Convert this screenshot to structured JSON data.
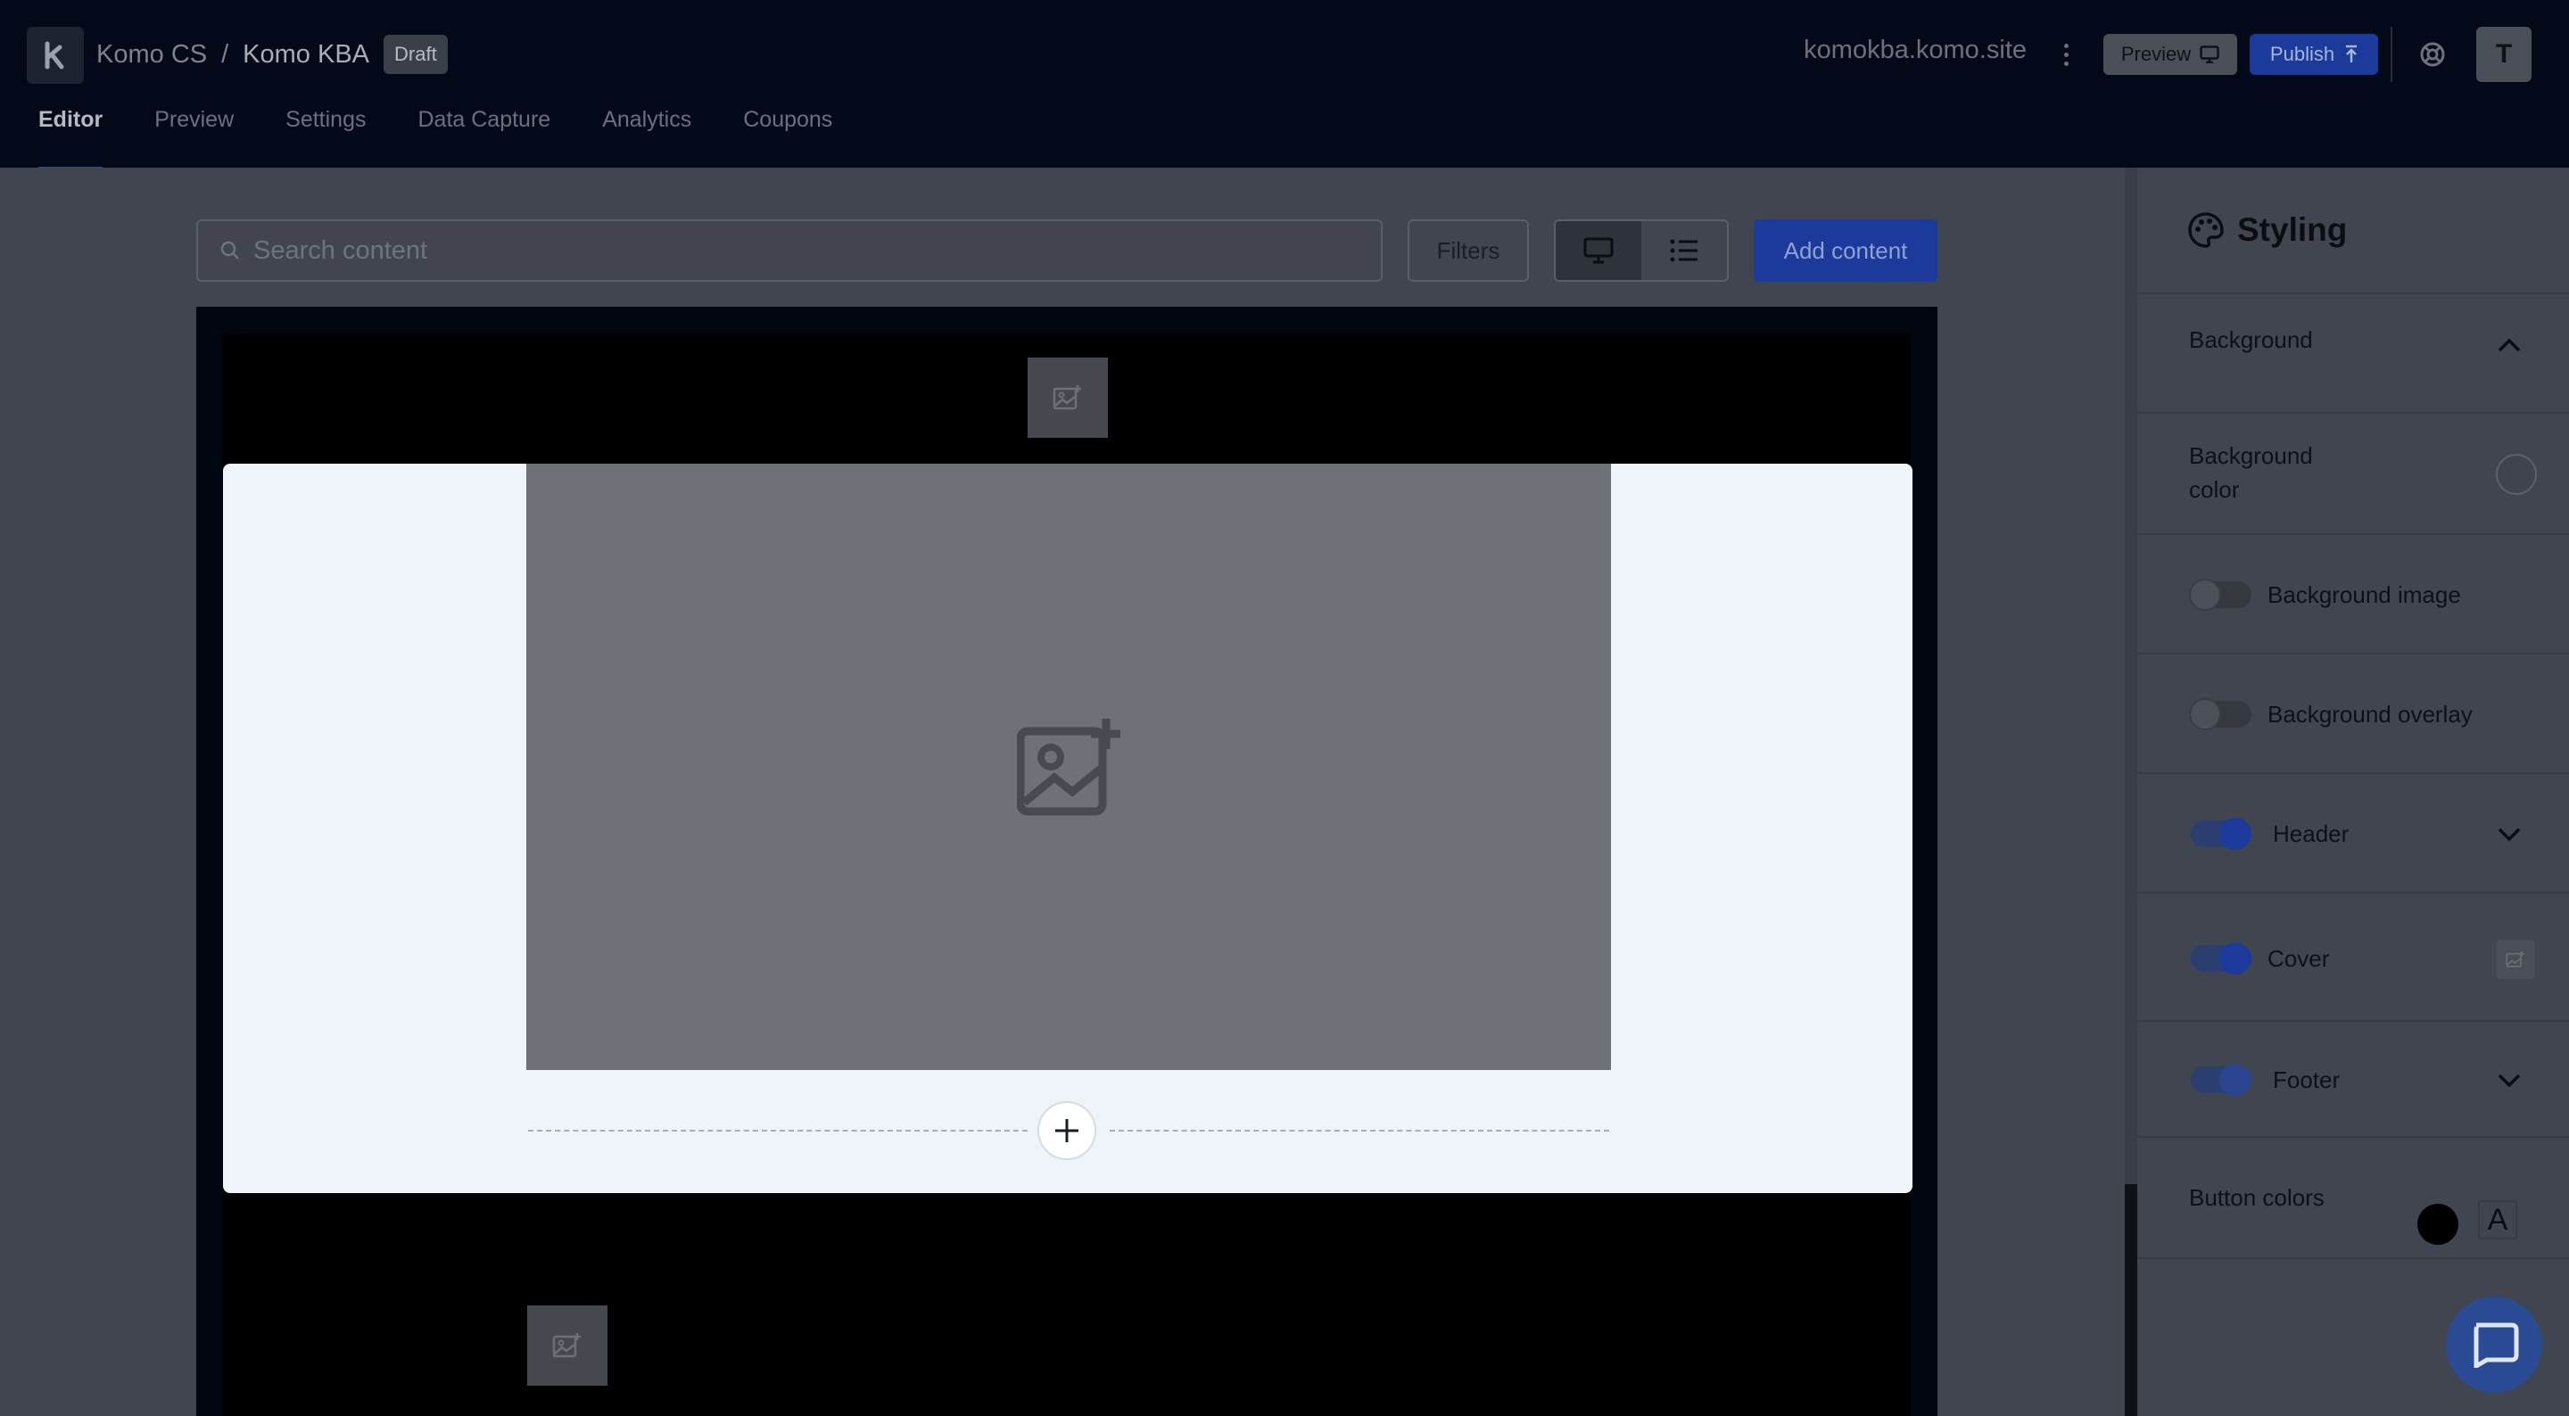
{
  "header": {
    "logo_letter": "k",
    "breadcrumb": {
      "org": "Komo CS",
      "separator": "/",
      "project": "Komo KBA",
      "status_badge": "Draft"
    },
    "site_url": "komokba.komo.site",
    "preview_label": "Preview",
    "publish_label": "Publish",
    "avatar_initial": "T"
  },
  "tabs": [
    {
      "label": "Editor",
      "active": true
    },
    {
      "label": "Preview"
    },
    {
      "label": "Settings"
    },
    {
      "label": "Data Capture"
    },
    {
      "label": "Analytics"
    },
    {
      "label": "Coupons"
    }
  ],
  "toolbar": {
    "search_placeholder": "Search content",
    "filters_label": "Filters",
    "add_content_label": "Add content"
  },
  "styling_panel": {
    "title": "Styling",
    "background_section": "Background",
    "background_color_label_line1": "Background",
    "background_color_label_line2": "color",
    "background_image_label": "Background image",
    "background_image_enabled": false,
    "background_overlay_label": "Background overlay",
    "background_overlay_enabled": false,
    "header_label": "Header",
    "header_enabled": true,
    "cover_label": "Cover",
    "cover_enabled": true,
    "footer_label": "Footer",
    "footer_enabled": true,
    "button_colors_label": "Button colors",
    "button_text_glyph": "A"
  },
  "colors": {
    "accent": "#1b3a9a",
    "topbar": "#030918",
    "canvas_cover": "#eef4fa"
  }
}
